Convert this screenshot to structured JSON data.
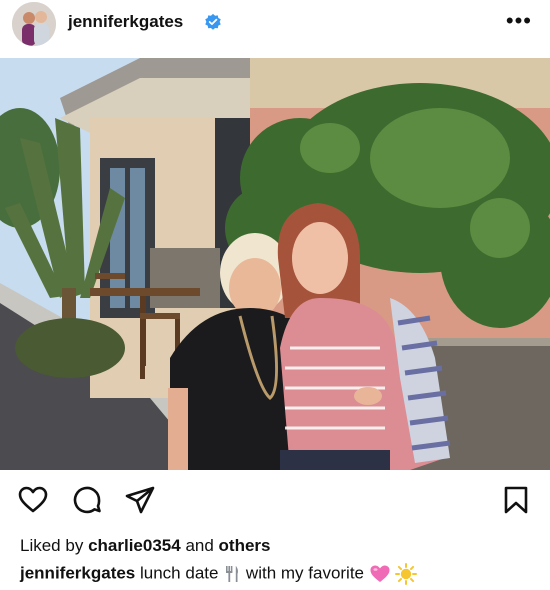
{
  "header": {
    "username": "jenniferkgates",
    "verified": true,
    "more_icon": "more-horizontal-icon"
  },
  "post": {
    "image_alt": "Two women smiling outside a restaurant with ivy-covered wall",
    "actions": {
      "like_icon": "heart-icon",
      "comment_icon": "comment-icon",
      "share_icon": "send-icon",
      "save_icon": "bookmark-icon"
    },
    "likes": {
      "prefix": "Liked by",
      "user": "charlie0354",
      "middle": "and",
      "suffix": "others"
    },
    "caption": {
      "user": "jenniferkgates",
      "text_1": "lunch date",
      "text_2": "with my favorite",
      "emojis": [
        "fork-knife-icon",
        "pink-heart-icon",
        "sun-icon"
      ]
    }
  },
  "colors": {
    "verified_blue": "#3897f0",
    "text": "#111111",
    "heart_pink": "#f06bb5",
    "sun_yellow": "#f6c630"
  }
}
